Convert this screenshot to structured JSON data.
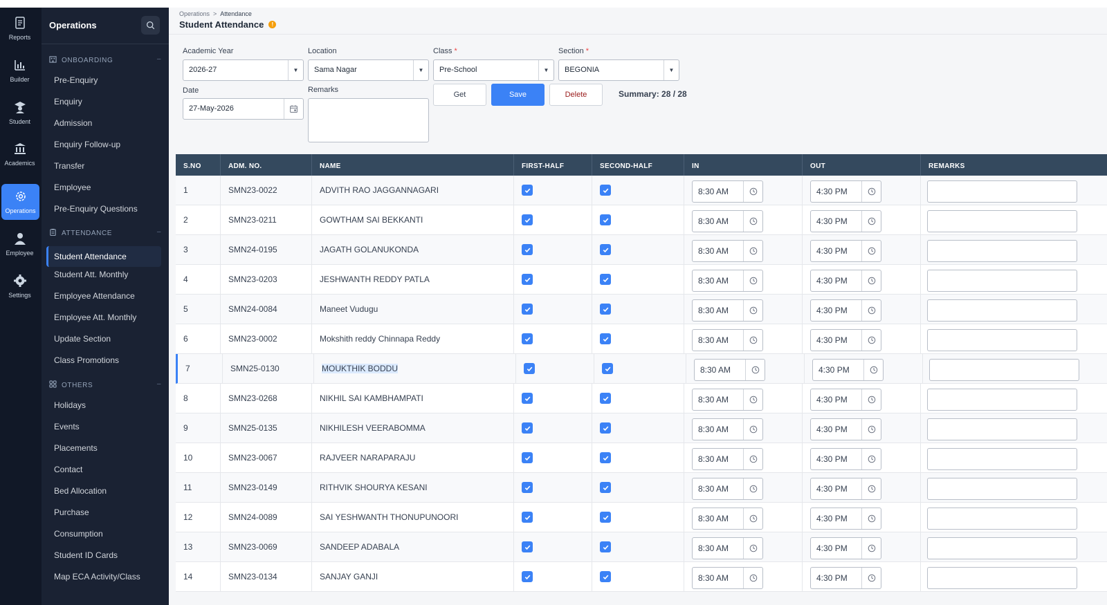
{
  "rail": [
    {
      "label": "Reports",
      "icon": "reports-icon"
    },
    {
      "label": "Builder",
      "icon": "builder-icon"
    },
    {
      "label": "Student",
      "icon": "student-icon"
    },
    {
      "label": "Academics",
      "icon": "academics-icon"
    },
    {
      "label": "Operations",
      "icon": "operations-icon",
      "active": true
    },
    {
      "label": "Employee",
      "icon": "employee-icon"
    },
    {
      "label": "Settings",
      "icon": "settings-icon"
    }
  ],
  "nav": {
    "title": "Operations",
    "sections": [
      {
        "title": "ONBOARDING",
        "icon": "building-icon",
        "items": [
          "Pre-Enquiry",
          "Enquiry",
          "Admission",
          "Enquiry Follow-up",
          "Transfer",
          "Employee",
          "Pre-Enquiry Questions"
        ]
      },
      {
        "title": "ATTENDANCE",
        "icon": "clipboard-icon",
        "items": [
          "Student Attendance",
          "Student Att. Monthly",
          "Employee Attendance",
          "Employee Att. Monthly",
          "Update Section",
          "Class Promotions"
        ]
      },
      {
        "title": "OTHERS",
        "icon": "grid-icon",
        "items": [
          "Holidays",
          "Events",
          "Placements",
          "Contact",
          "Bed Allocation",
          "Purchase",
          "Consumption",
          "Student ID Cards",
          "Map ECA Activity/Class"
        ]
      }
    ],
    "active_item": "Student Attendance"
  },
  "breadcrumb": {
    "parent": "Operations",
    "current": "Attendance"
  },
  "page_title": "Student Attendance",
  "form": {
    "academic_year": {
      "label": "Academic Year",
      "value": "2026-27"
    },
    "location": {
      "label": "Location",
      "value": "Sama Nagar"
    },
    "class": {
      "label": "Class",
      "value": "Pre-School",
      "required": "*"
    },
    "section": {
      "label": "Section",
      "value": "BEGONIA",
      "required": "*"
    },
    "date": {
      "label": "Date",
      "value": "27-May-2026"
    },
    "remarks": {
      "label": "Remarks",
      "value": ""
    },
    "get_label": "Get",
    "save_label": "Save",
    "delete_label": "Delete",
    "summary": "Summary: 28 / 28"
  },
  "table": {
    "headers": [
      "S.NO",
      "ADM. NO.",
      "NAME",
      "FIRST-HALF",
      "SECOND-HALF",
      "IN",
      "OUT",
      "REMARKS"
    ],
    "rows": [
      {
        "sno": "1",
        "adm": "SMN23-0022",
        "name": "ADVITH RAO JAGGANNAGARI",
        "first": true,
        "second": true,
        "in": "8:30 AM",
        "out": "4:30 PM"
      },
      {
        "sno": "2",
        "adm": "SMN23-0211",
        "name": "GOWTHAM SAI BEKKANTI",
        "first": true,
        "second": true,
        "in": "8:30 AM",
        "out": "4:30 PM"
      },
      {
        "sno": "3",
        "adm": "SMN24-0195",
        "name": "JAGATH GOLANUKONDA",
        "first": true,
        "second": true,
        "in": "8:30 AM",
        "out": "4:30 PM"
      },
      {
        "sno": "4",
        "adm": "SMN23-0203",
        "name": "JESHWANTH REDDY PATLA",
        "first": true,
        "second": true,
        "in": "8:30 AM",
        "out": "4:30 PM"
      },
      {
        "sno": "5",
        "adm": "SMN24-0084",
        "name": "Maneet Vudugu",
        "first": true,
        "second": true,
        "in": "8:30 AM",
        "out": "4:30 PM"
      },
      {
        "sno": "6",
        "adm": "SMN23-0002",
        "name": "Mokshith reddy Chinnapa Reddy",
        "first": true,
        "second": true,
        "in": "8:30 AM",
        "out": "4:30 PM"
      },
      {
        "sno": "7",
        "adm": "SMN25-0130",
        "name": "MOUKTHIK BODDU",
        "first": true,
        "second": true,
        "in": "8:30 AM",
        "out": "4:30 PM",
        "selected": true
      },
      {
        "sno": "8",
        "adm": "SMN23-0268",
        "name": "NIKHIL SAI KAMBHAMPATI",
        "first": true,
        "second": true,
        "in": "8:30 AM",
        "out": "4:30 PM"
      },
      {
        "sno": "9",
        "adm": "SMN25-0135",
        "name": "NIKHILESH VEERABOMMA",
        "first": true,
        "second": true,
        "in": "8:30 AM",
        "out": "4:30 PM"
      },
      {
        "sno": "10",
        "adm": "SMN23-0067",
        "name": "RAJVEER NARAPARAJU",
        "first": true,
        "second": true,
        "in": "8:30 AM",
        "out": "4:30 PM"
      },
      {
        "sno": "11",
        "adm": "SMN23-0149",
        "name": "RITHVIK SHOURYA KESANI",
        "first": true,
        "second": true,
        "in": "8:30 AM",
        "out": "4:30 PM"
      },
      {
        "sno": "12",
        "adm": "SMN24-0089",
        "name": "SAI YESHWANTH THONUPUNOORI",
        "first": true,
        "second": true,
        "in": "8:30 AM",
        "out": "4:30 PM"
      },
      {
        "sno": "13",
        "adm": "SMN23-0069",
        "name": "SANDEEP ADABALA",
        "first": true,
        "second": true,
        "in": "8:30 AM",
        "out": "4:30 PM"
      },
      {
        "sno": "14",
        "adm": "SMN23-0134",
        "name": "SANJAY GANJI",
        "first": true,
        "second": true,
        "in": "8:30 AM",
        "out": "4:30 PM"
      }
    ]
  },
  "colors": {
    "accent": "#3b82f6",
    "rail_bg": "#111827",
    "nav_bg": "#1a2233",
    "table_header": "#34495e"
  }
}
